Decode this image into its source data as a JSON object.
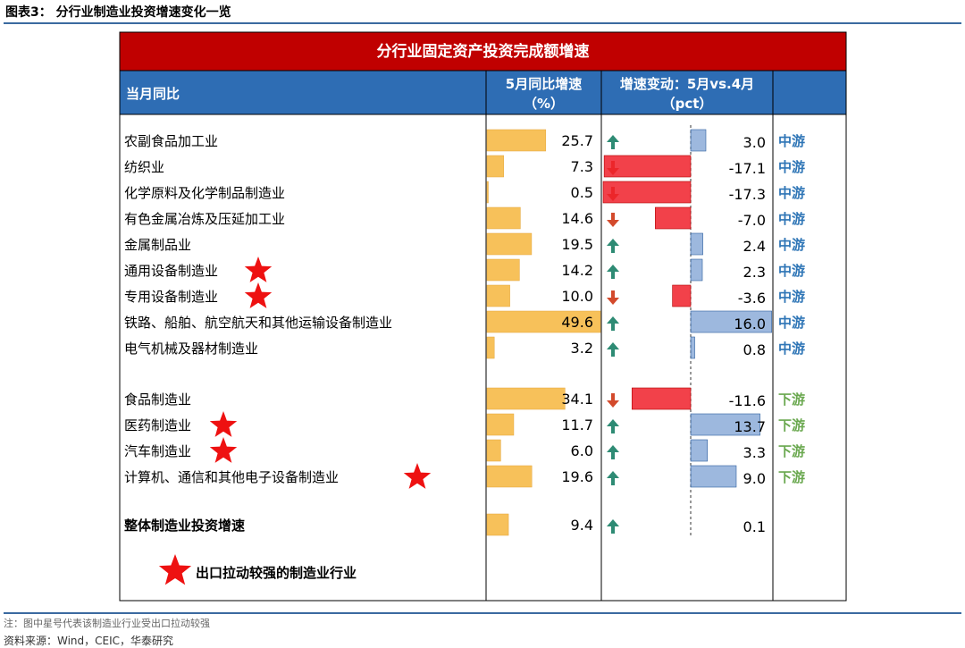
{
  "figure_title": "图表3：  分行业制造业投资增速变化一览",
  "note": "注：图中星号代表该制造业行业受出口拉动较强",
  "source": "资料来源：Wind，CEIC，华泰研究",
  "colors": {
    "header_red": "#c00000",
    "header_blue": "#2e6db4",
    "bar_yellow": "#f7c15a",
    "bar_red": "#f0202a",
    "bar_blue": "#4d7ec2",
    "arrow_up": "#2e8b74",
    "arrow_down": "#d34a2c",
    "midstream": "#2e75b6",
    "downstream": "#6aa84f",
    "star": "#ee1111"
  },
  "chart_data": {
    "type": "table",
    "title": "分行业固定资产投资完成额增速",
    "columns": [
      "当月同比",
      "5月同比增速（%）",
      "增速变动：5月vs.4月（pct）",
      ""
    ],
    "col_headers": {
      "c1": "当月同比",
      "c2a": "5月同比增速",
      "c2b": "（%）",
      "c3a": "增速变动：5月vs.4月",
      "c3b": "（pct）"
    },
    "groups": [
      {
        "rows": [
          {
            "name": "农副食品加工业",
            "growth": 25.7,
            "growth_label": "25.7",
            "change": 3.0,
            "change_label": "3.0",
            "stream": "中游",
            "star": false
          },
          {
            "name": "纺织业",
            "growth": 7.3,
            "growth_label": "7.3",
            "change": -17.1,
            "change_label": "-17.1",
            "stream": "中游",
            "star": false
          },
          {
            "name": "化学原料及化学制品制造业",
            "growth": 0.5,
            "growth_label": "0.5",
            "change": -17.3,
            "change_label": "-17.3",
            "stream": "中游",
            "star": false
          },
          {
            "name": "有色金属冶炼及压延加工业",
            "growth": 14.6,
            "growth_label": "14.6",
            "change": -7.0,
            "change_label": "-7.0",
            "stream": "中游",
            "star": false
          },
          {
            "name": "金属制品业",
            "growth": 19.5,
            "growth_label": "19.5",
            "change": 2.4,
            "change_label": "2.4",
            "stream": "中游",
            "star": false
          },
          {
            "name": "通用设备制造业",
            "growth": 14.2,
            "growth_label": "14.2",
            "change": 2.3,
            "change_label": "2.3",
            "stream": "中游",
            "star": true
          },
          {
            "name": "专用设备制造业",
            "growth": 10.0,
            "growth_label": "10.0",
            "change": -3.6,
            "change_label": "-3.6",
            "stream": "中游",
            "star": true
          },
          {
            "name": "铁路、船舶、航空航天和其他运输设备制造业",
            "growth": 49.6,
            "growth_label": "49.6",
            "change": 16.0,
            "change_label": "16.0",
            "stream": "中游",
            "star": false
          },
          {
            "name": "电气机械及器材制造业",
            "growth": 3.2,
            "growth_label": "3.2",
            "change": 0.8,
            "change_label": "0.8",
            "stream": "中游",
            "star": false
          }
        ]
      },
      {
        "rows": [
          {
            "name": "食品制造业",
            "growth": 34.1,
            "growth_label": "34.1",
            "change": -11.6,
            "change_label": "-11.6",
            "stream": "下游",
            "star": false
          },
          {
            "name": "医药制造业",
            "growth": 11.7,
            "growth_label": "11.7",
            "change": 13.7,
            "change_label": "13.7",
            "stream": "下游",
            "star": true
          },
          {
            "name": "汽车制造业",
            "growth": 6.0,
            "growth_label": "6.0",
            "change": 3.3,
            "change_label": "3.3",
            "stream": "下游",
            "star": true
          },
          {
            "name": "计算机、通信和其他电子设备制造业",
            "growth": 19.6,
            "growth_label": "19.6",
            "change": 9.0,
            "change_label": "9.0",
            "stream": "下游",
            "star": true
          }
        ]
      }
    ],
    "total": {
      "name": "整体制造业投资增速",
      "growth": 9.4,
      "growth_label": "9.4",
      "change": 0.1,
      "change_label": "0.1"
    },
    "legend_text": "出口拉动较强的制造业行业",
    "growth_range": [
      0,
      49.6
    ],
    "change_range": [
      -17.3,
      16.0
    ]
  }
}
